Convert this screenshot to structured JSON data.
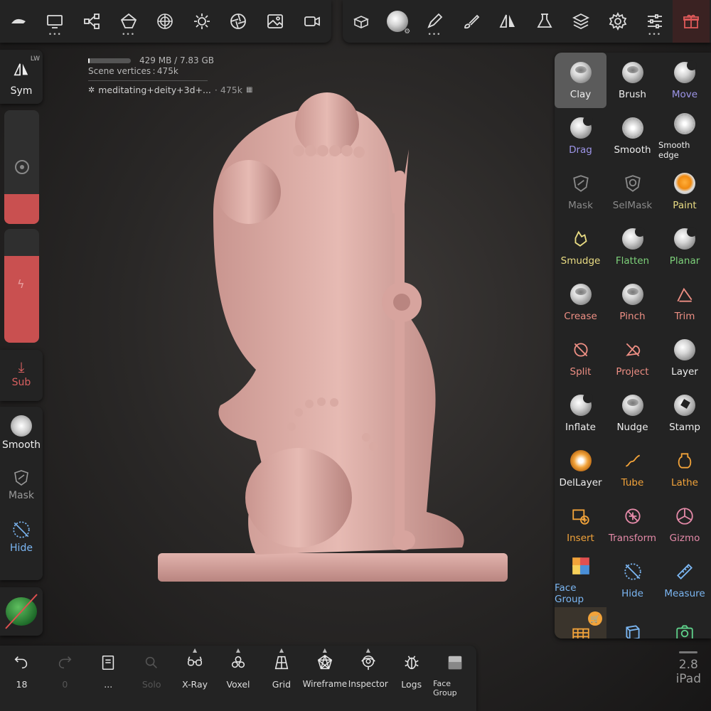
{
  "top_left_icons": [
    "sculpt-logo-icon",
    "monitor-icon",
    "scene-graph-icon",
    "primitive-icon",
    "topology-icon",
    "light-icon",
    "aperture-icon",
    "image-icon",
    "video-icon"
  ],
  "top_right_icons": [
    "boxes-icon",
    "material-sphere-icon",
    "brush-pen-icon",
    "paint-brush-icon",
    "symmetry-icon",
    "flask-icon",
    "layers-icon",
    "gear-icon",
    "sliders-icon",
    "gift-icon"
  ],
  "hud": {
    "memory": "429 MB / 7.83 GB",
    "memory_fraction": 0.05,
    "vertices": "Scene vertices : 475k",
    "file_name": "meditating+deity+3d+...",
    "file_verts": "· 475k"
  },
  "left": {
    "sym_label": "Sym",
    "sym_mode": "LW",
    "sub_label": "Sub",
    "tools": [
      {
        "label": "Smooth",
        "icon": "smooth-icon"
      },
      {
        "label": "Mask",
        "icon": "mask-icon"
      },
      {
        "label": "Hide",
        "icon": "hide-icon"
      }
    ]
  },
  "tools": [
    {
      "label": "Clay",
      "color": "white",
      "icon": "clay-icon",
      "selected": true
    },
    {
      "label": "Brush",
      "color": "white",
      "icon": "brush-icon"
    },
    {
      "label": "Move",
      "color": "purple",
      "icon": "move-icon"
    },
    {
      "label": "Drag",
      "color": "purple",
      "icon": "drag-icon"
    },
    {
      "label": "Smooth",
      "color": "white",
      "icon": "smooth-icon"
    },
    {
      "label": "Smooth edge",
      "color": "white",
      "icon": "smooth-edge-icon"
    },
    {
      "label": "Mask",
      "color": "grey",
      "icon": "mask-icon"
    },
    {
      "label": "SelMask",
      "color": "grey",
      "icon": "selmask-icon"
    },
    {
      "label": "Paint",
      "color": "yellow",
      "icon": "paint-icon"
    },
    {
      "label": "Smudge",
      "color": "yellow",
      "icon": "smudge-icon"
    },
    {
      "label": "Flatten",
      "color": "green",
      "icon": "flatten-icon"
    },
    {
      "label": "Planar",
      "color": "green",
      "icon": "planar-icon"
    },
    {
      "label": "Crease",
      "color": "red",
      "icon": "crease-icon"
    },
    {
      "label": "Pinch",
      "color": "red",
      "icon": "pinch-icon"
    },
    {
      "label": "Trim",
      "color": "red",
      "icon": "trim-icon"
    },
    {
      "label": "Split",
      "color": "red",
      "icon": "split-icon"
    },
    {
      "label": "Project",
      "color": "red",
      "icon": "project-icon"
    },
    {
      "label": "Layer",
      "color": "white",
      "icon": "layer-icon"
    },
    {
      "label": "Inflate",
      "color": "white",
      "icon": "inflate-icon"
    },
    {
      "label": "Nudge",
      "color": "white",
      "icon": "nudge-icon"
    },
    {
      "label": "Stamp",
      "color": "white",
      "icon": "stamp-icon"
    },
    {
      "label": "DelLayer",
      "color": "white",
      "icon": "dellayer-icon"
    },
    {
      "label": "Tube",
      "color": "orange",
      "icon": "tube-icon"
    },
    {
      "label": "Lathe",
      "color": "orange",
      "icon": "lathe-icon"
    },
    {
      "label": "Insert",
      "color": "orange",
      "icon": "insert-icon"
    },
    {
      "label": "Transform",
      "color": "pink",
      "icon": "transform-icon"
    },
    {
      "label": "Gizmo",
      "color": "pink",
      "icon": "gizmo-icon"
    },
    {
      "label": "Face Group",
      "color": "blue",
      "icon": "face-group-icon"
    },
    {
      "label": "Hide",
      "color": "blue",
      "icon": "hide-icon"
    },
    {
      "label": "Measure",
      "color": "blue",
      "icon": "measure-icon"
    },
    {
      "label": "",
      "color": "white",
      "icon": "shop-icon"
    },
    {
      "label": "",
      "color": "white",
      "icon": "box-select-icon"
    },
    {
      "label": "",
      "color": "white",
      "icon": "camera-icon"
    }
  ],
  "bottom": [
    {
      "label": "18",
      "icon": "undo-icon",
      "disabled": false
    },
    {
      "label": "0",
      "icon": "redo-icon",
      "disabled": true
    },
    {
      "label": "...",
      "icon": "notebook-icon",
      "disabled": false
    },
    {
      "label": "Solo",
      "icon": "search-icon",
      "disabled": true
    },
    {
      "label": "X-Ray",
      "icon": "glasses-icon",
      "disabled": false,
      "caret": true
    },
    {
      "label": "Voxel",
      "icon": "voxel-icon",
      "disabled": false,
      "caret": true
    },
    {
      "label": "Grid",
      "icon": "grid-icon",
      "disabled": false,
      "caret": true
    },
    {
      "label": "Wireframe",
      "icon": "wireframe-icon",
      "disabled": false,
      "caret": true
    },
    {
      "label": "Inspector",
      "icon": "inspector-icon",
      "disabled": false,
      "caret": true
    },
    {
      "label": "Logs",
      "icon": "bug-icon",
      "disabled": false
    },
    {
      "label": "Face Group",
      "icon": "face-group-square-icon",
      "disabled": false
    }
  ],
  "version": {
    "number": "2.8",
    "device": "iPad"
  },
  "colors": {
    "accent_red": "#c95050",
    "model": "#d8aaa4",
    "panel": "#232323"
  }
}
